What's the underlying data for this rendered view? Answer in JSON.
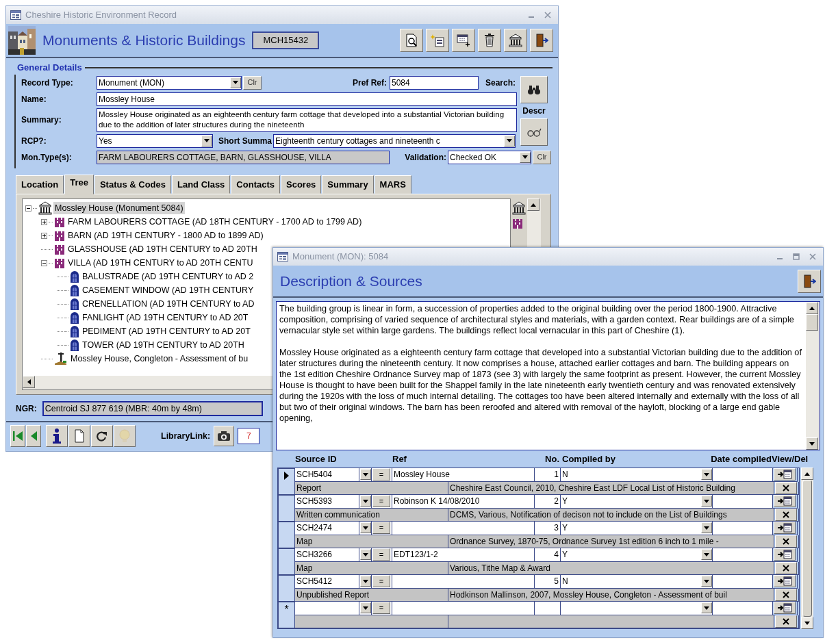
{
  "main_window": {
    "title": "Cheshire Historic Environment Record",
    "window_controls": [
      {
        "kind": "minimize"
      },
      {
        "kind": "close"
      }
    ],
    "heading": "Monuments & Historic Buildings",
    "record_id": "MCH15432",
    "toolbar": [
      {
        "kind": "preview"
      },
      {
        "kind": "new"
      },
      {
        "kind": "add"
      },
      {
        "kind": "delete"
      },
      {
        "kind": "monument"
      },
      {
        "kind": "exit"
      }
    ],
    "general_details": {
      "legend": "General Details",
      "record_type": {
        "label": "Record Type:",
        "value": "Monument (MON)",
        "clear": "Clr"
      },
      "pref_ref": {
        "label": "Pref Ref:",
        "value": "5084"
      },
      "search": {
        "label": "Search:"
      },
      "name": {
        "label": "Name:",
        "value": "Mossley House"
      },
      "summary": {
        "label": "Summary:",
        "value": "Mossley House originated as an eighteenth century farm cottage that developed into a substantial Victorian building due to the addition of later structures during the nineteenth"
      },
      "descr": {
        "label": "Descr"
      },
      "rcp": {
        "label": "RCP?:",
        "value": "Yes"
      },
      "short_summary": {
        "label": "Short Summa",
        "value": "Eighteenth century cottages and nineteenth c"
      },
      "mon_types": {
        "label": "Mon.Type(s):",
        "value": "FARM LABOURERS COTTAGE, BARN, GLASSHOUSE, VILLA"
      },
      "validation": {
        "label": "Validation:",
        "value": "Checked OK",
        "clear": "Clr"
      }
    },
    "tabs": [
      {
        "label": "Location",
        "selected": false
      },
      {
        "label": "Tree",
        "selected": true
      },
      {
        "label": "Status & Codes",
        "selected": false
      },
      {
        "label": "Land Class",
        "selected": false
      },
      {
        "label": "Contacts",
        "selected": false
      },
      {
        "label": "Scores",
        "selected": false
      },
      {
        "label": "Summary",
        "selected": false
      },
      {
        "label": "MARS",
        "selected": false
      }
    ],
    "tree": [
      {
        "kind": "monument",
        "label": "Mossley House (Monument 5084)",
        "selected": true,
        "expanded": true,
        "children": [
          {
            "kind": "component",
            "label": "FARM LABOURERS COTTAGE (AD 18TH CENTURY - 1700 AD to 1799 AD)",
            "selected": false,
            "expanded": false
          },
          {
            "kind": "component",
            "label": "BARN (AD 19TH CENTURY - 1800 AD to 1899 AD)",
            "selected": false,
            "expanded": false
          },
          {
            "kind": "component",
            "label": "GLASSHOUSE (AD 19TH CENTURY to AD 20TH",
            "selected": false
          },
          {
            "kind": "component",
            "label": "VILLA (AD 19TH CENTURY to AD 20TH CENTU",
            "selected": false,
            "expanded": true,
            "children": [
              {
                "kind": "feature",
                "label": "BALUSTRADE (AD 19TH CENTURY to AD 2",
                "selected": false
              },
              {
                "kind": "feature",
                "label": "CASEMENT WINDOW (AD 19TH CENTURY",
                "selected": false
              },
              {
                "kind": "feature",
                "label": "CRENELLATION (AD 19TH CENTURY to AD",
                "selected": false
              },
              {
                "kind": "feature",
                "label": "FANLIGHT (AD 19TH CENTURY to AD 20T",
                "selected": false
              },
              {
                "kind": "feature",
                "label": "PEDIMENT (AD 19TH CENTURY to AD 20T",
                "selected": false
              },
              {
                "kind": "feature",
                "label": "TOWER (AD 19TH CENTURY to AD 20TH",
                "selected": false
              }
            ]
          },
          {
            "kind": "source",
            "label": "Mossley House, Congleton - Assessment of bu",
            "selected": false
          }
        ]
      }
    ],
    "tree_side_buttons": [
      {
        "kind": "monument"
      },
      {
        "kind": "component"
      }
    ],
    "ngr": {
      "label": "NGR:",
      "value": "Centroid SJ 877 619  (MBR: 40m by 48m)"
    },
    "nav_buttons": [
      {
        "kind": "first",
        "disabled": false
      },
      {
        "kind": "previous",
        "disabled": false
      },
      {
        "kind": "info",
        "disabled": false
      },
      {
        "kind": "new",
        "disabled": false
      },
      {
        "kind": "refresh",
        "disabled": false
      },
      {
        "kind": "bulb",
        "disabled": true
      }
    ],
    "library_link": {
      "label": "LibraryLink:",
      "count": "7"
    }
  },
  "description_window": {
    "title": "Monument (MON): 5084",
    "window_controls": [
      {
        "kind": "minimize"
      },
      {
        "kind": "maximize"
      },
      {
        "kind": "close"
      }
    ],
    "heading": "Description & Sources",
    "description": [
      "The building group is linear in form, a succession of properties added to the original building over the period 1800-1900. Attractive composition, comprising of varied sequence of architectural styles and materials, with a garden context. Rear buildings are of a simple vernacular style set within large gardens. The buildings reflect local vernacular in this part of Cheshire (1).",
      "Mossley House originated as a eighteenth century farm cottage that developed into a substantial Victorian building due to the addition of later structures during the nineteenth century. It now comprises a house, attached earlier cottages and barn. The building appears on the 1st edition Cheshire Ordnance Survey map of 1873 (see 3) with largely the same footprint as present. However, the current Mossley House is thought to have been built for the Shappel family in the late nineteenth early twentieth century and was renovated extensively during the 1920s with the loss of much internal detailing. The cottages too have been altered internally and externally with the loss of all but two of their original windows. The barn has been reroofed and altered with removal of the hayloft, blocking of a large end gable opening,"
    ],
    "sources": {
      "columns": [
        "Source ID",
        "Ref",
        "No.",
        "Compiled by",
        "Date compiled",
        "View/Del"
      ],
      "rows": [
        {
          "selected": true,
          "source_id": "SCH5404",
          "lookup": "=",
          "ref": "Mossley House",
          "no": "1",
          "compiled_by": "N",
          "type": "Report",
          "citation": "Cheshire East Council, 2010, Cheshire East LDF Local List of Historic Building"
        },
        {
          "selected": false,
          "source_id": "SCH5393",
          "lookup": "=",
          "ref": "Robinson K 14/08/2010",
          "no": "2",
          "compiled_by": "Y",
          "type": "Written communication",
          "citation": "DCMS, Various, Notification of decison not to include on the List of Buildings"
        },
        {
          "selected": false,
          "source_id": "SCH2474",
          "lookup": "=",
          "ref": "",
          "no": "3",
          "compiled_by": "Y",
          "type": "Map",
          "citation": "Ordnance Survey, 1870-75, Ordnance Survey 1st edition 6 inch to 1 mile -"
        },
        {
          "selected": false,
          "source_id": "SCH3266",
          "lookup": "=",
          "ref": "EDT123/1-2",
          "no": "4",
          "compiled_by": "Y",
          "type": "Map",
          "citation": "Various, Tithe Map & Award"
        },
        {
          "selected": false,
          "source_id": "SCH5412",
          "lookup": "=",
          "ref": "",
          "no": "5",
          "compiled_by": "N",
          "type": "Unpublished Report",
          "citation": "Hodkinson Mallinson, 2007, Mossley House, Congleton - Assessment of buil"
        }
      ],
      "new_row": {
        "marker": "*",
        "lookup": "="
      }
    }
  }
}
